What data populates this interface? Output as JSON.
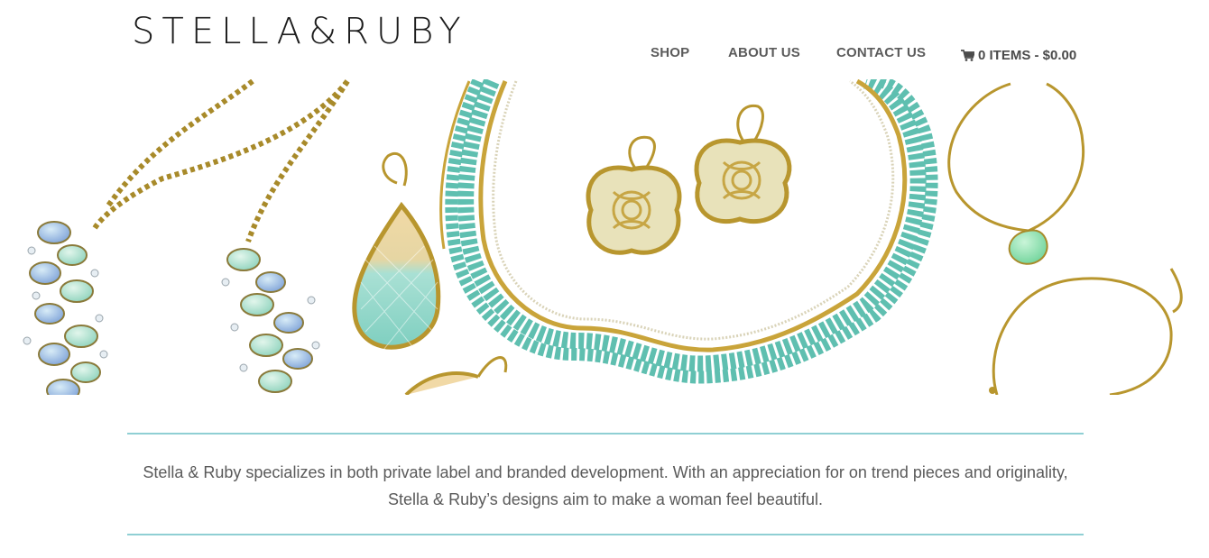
{
  "header": {
    "logo_text": "STELLA&RUBY",
    "nav": {
      "shop": "SHOP",
      "about": "ABOUT US",
      "contact": "CONTACT US"
    },
    "cart": {
      "icon": "shopping-cart-icon",
      "label": "0 ITEMS - $0.00"
    }
  },
  "hero": {
    "image_subject": "jewelry-banner-image"
  },
  "intro": {
    "text": "Stella & Ruby specializes in both private label and branded development. With an appreciation for on trend pieces and originality, Stella & Ruby’s designs aim to make a woman feel beautiful."
  },
  "colors": {
    "divider": "#8fcfd4",
    "text": "#5a5a5a",
    "gold": "#b8962e",
    "turquoise": "#5fbfb0"
  }
}
